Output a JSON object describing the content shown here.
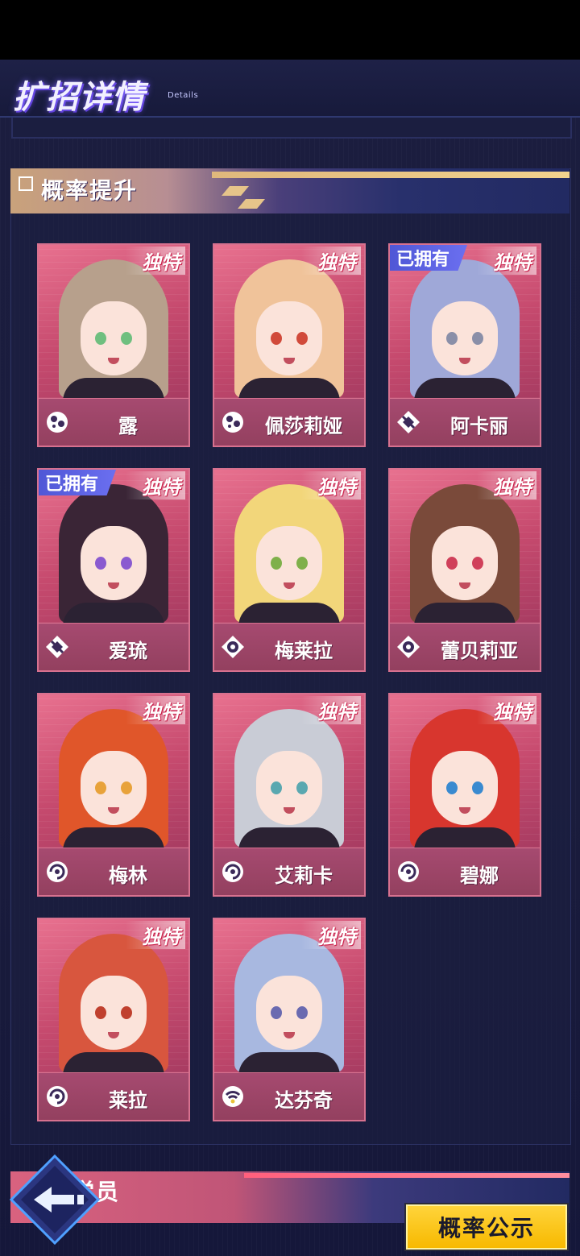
{
  "header": {
    "title": "扩招详情",
    "subtitle": "Details"
  },
  "section": {
    "title": "概率提升"
  },
  "badges": {
    "unique": "独特",
    "owned": "已拥有"
  },
  "characters": [
    {
      "name": "露",
      "class_icon": "orbit-icon",
      "owned": false,
      "hair": "#b7a08c",
      "eye": "#6fbf7f"
    },
    {
      "name": "佩莎莉娅",
      "class_icon": "orbit-icon",
      "owned": false,
      "hair": "#f0c39a",
      "eye": "#d14a3a"
    },
    {
      "name": "阿卡丽",
      "class_icon": "diamond-icon",
      "owned": true,
      "hair": "#9fa8d8",
      "eye": "#8a8fa8"
    },
    {
      "name": "爱琉",
      "class_icon": "diamond-icon",
      "owned": true,
      "hair": "#3a2536",
      "eye": "#8a5ad0"
    },
    {
      "name": "梅莱拉",
      "class_icon": "ring-icon",
      "owned": false,
      "hair": "#f2d67a",
      "eye": "#7fb04a"
    },
    {
      "name": "蕾贝莉亚",
      "class_icon": "ring-icon",
      "owned": false,
      "hair": "#7a4a3a",
      "eye": "#d0405a"
    },
    {
      "name": "梅林",
      "class_icon": "swirl-icon",
      "owned": false,
      "hair": "#e0562a",
      "eye": "#e8a23a"
    },
    {
      "name": "艾莉卡",
      "class_icon": "swirl-icon",
      "owned": false,
      "hair": "#c9ccd6",
      "eye": "#5aa8b0"
    },
    {
      "name": "碧娜",
      "class_icon": "swirl-icon",
      "owned": false,
      "hair": "#d8362e",
      "eye": "#3a8ad0"
    },
    {
      "name": "莱拉",
      "class_icon": "swirl-icon",
      "owned": false,
      "hair": "#d8563e",
      "eye": "#c0402e"
    },
    {
      "name": "达芬奇",
      "class_icon": "wifi-icon",
      "owned": false,
      "hair": "#a8b8e0",
      "eye": "#6a6ab0"
    }
  ],
  "bottom_section": {
    "title": "学员"
  },
  "buttons": {
    "probability": "概率公示",
    "back": "back"
  },
  "colors": {
    "card": "#b04c6e",
    "accent": "#ffd43b",
    "background": "#1b1d3f"
  }
}
